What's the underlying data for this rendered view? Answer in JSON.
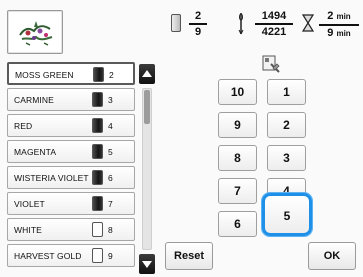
{
  "design": {
    "preview_icon": "embroidery-design-thumbnail"
  },
  "color_list": {
    "items": [
      {
        "name": "MOSS GREEN",
        "number": "2",
        "spool": "dark",
        "selected": true
      },
      {
        "name": "CARMINE",
        "number": "3",
        "spool": "dark",
        "selected": false
      },
      {
        "name": "RED",
        "number": "4",
        "spool": "dark",
        "selected": false
      },
      {
        "name": "MAGENTA",
        "number": "5",
        "spool": "dark",
        "selected": false
      },
      {
        "name": "WISTERIA VIOLET",
        "number": "6",
        "spool": "dark",
        "selected": false
      },
      {
        "name": "VIOLET",
        "number": "7",
        "spool": "dark",
        "selected": false
      },
      {
        "name": "WHITE",
        "number": "8",
        "spool": "light",
        "selected": false
      },
      {
        "name": "HARVEST GOLD",
        "number": "9",
        "spool": "light",
        "selected": false
      }
    ],
    "scroll_up_icon": "triangle-up-icon",
    "scroll_down_icon": "triangle-down-icon"
  },
  "status": {
    "color_current": "2",
    "color_total": "9",
    "stitch_current": "1494",
    "stitch_total": "4221",
    "time_current": "2",
    "time_total": "9",
    "time_unit": "min"
  },
  "keypad": {
    "keys": [
      "10",
      "1",
      "9",
      "2",
      "8",
      "3",
      "7",
      "4",
      "6",
      "5"
    ],
    "highlighted": "5",
    "highlight_color": "#1e90e8"
  },
  "buttons": {
    "reset_label": "Reset",
    "ok_label": "OK"
  }
}
